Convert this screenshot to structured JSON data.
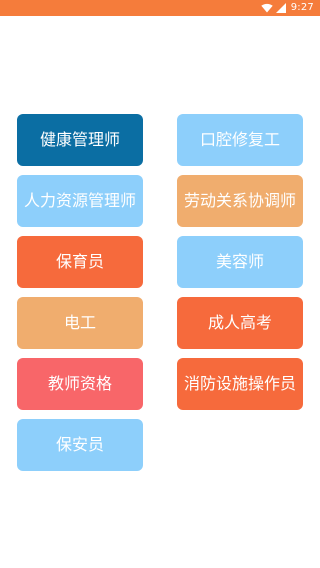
{
  "status_bar": {
    "time": "9:27",
    "wifi_icon": "wifi-icon",
    "signal_icon": "signal-icon",
    "color": "#f57c3b"
  },
  "categories": {
    "left": [
      {
        "label": "健康管理师",
        "color": "#0b6ea3"
      },
      {
        "label": "人力资源管理师",
        "color": "#8dcffb"
      },
      {
        "label": "保育员",
        "color": "#f66a3c"
      },
      {
        "label": "电工",
        "color": "#f0ad6e"
      },
      {
        "label": "教师资格",
        "color": "#f86669"
      },
      {
        "label": "保安员",
        "color": "#8dcffb"
      }
    ],
    "right": [
      {
        "label": "口腔修复工",
        "color": "#8dcffb"
      },
      {
        "label": "劳动关系协调师",
        "color": "#f0ad6e"
      },
      {
        "label": "美容师",
        "color": "#8dcffb"
      },
      {
        "label": "成人高考",
        "color": "#f66a3c"
      },
      {
        "label": "消防设施操作员",
        "color": "#f66a3c"
      }
    ]
  }
}
